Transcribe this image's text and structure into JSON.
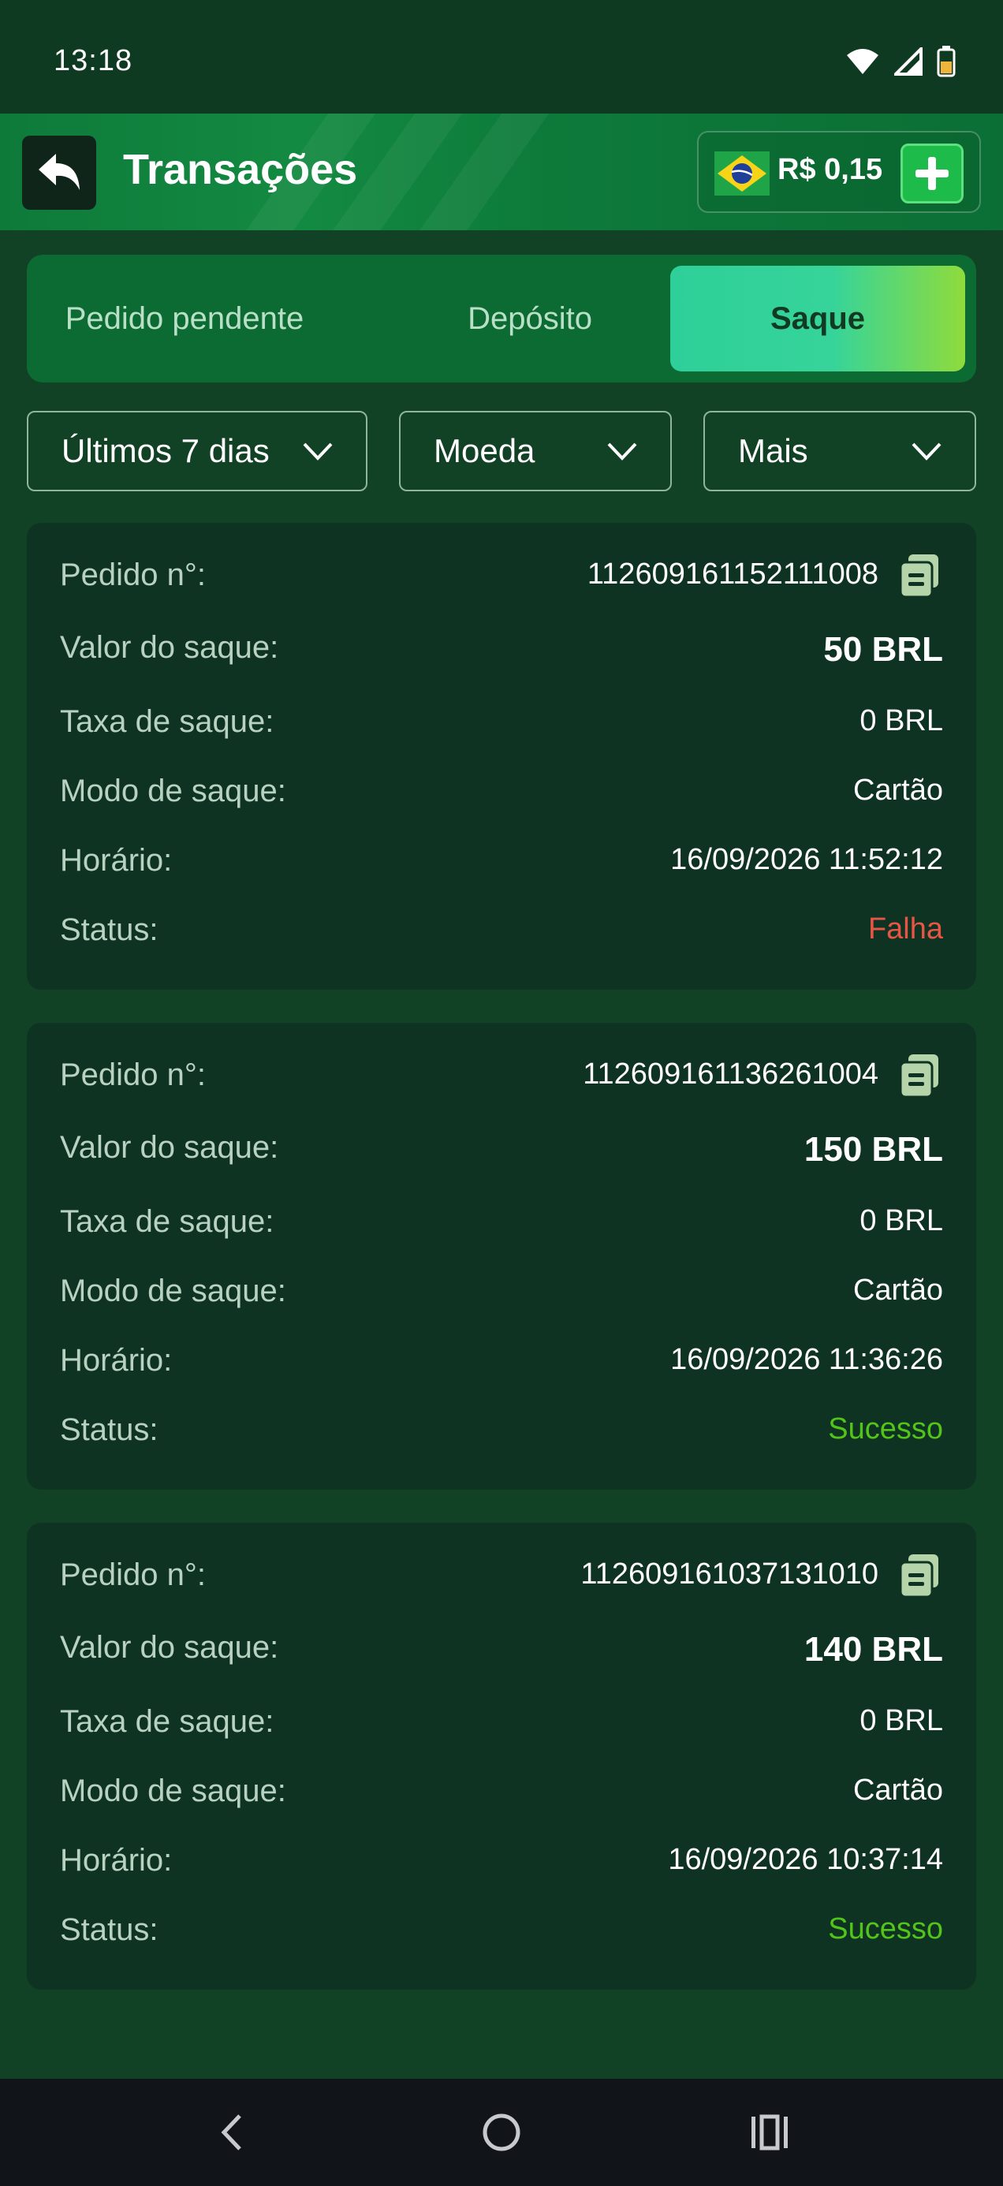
{
  "status_bar": {
    "time": "13:18"
  },
  "header": {
    "title": "Transações",
    "balance": "R$ 0,15"
  },
  "tabs": [
    {
      "label": "Pedido pendente",
      "active": false
    },
    {
      "label": "Depósito",
      "active": false
    },
    {
      "label": "Saque",
      "active": true
    }
  ],
  "filters": [
    {
      "label": "Últimos 7 dias"
    },
    {
      "label": "Moeda"
    },
    {
      "label": "Mais"
    }
  ],
  "labels": {
    "order": "Pedido n°:",
    "amount": "Valor do saque:",
    "fee": "Taxa de saque:",
    "mode": "Modo de saque:",
    "time": "Horário:",
    "status": "Status:"
  },
  "transactions": [
    {
      "order": "112609161152111008",
      "amount": "50 BRL",
      "fee": "0 BRL",
      "mode": "Cartão",
      "time": "16/09/2026 11:52:12",
      "status": "Falha"
    },
    {
      "order": "112609161136261004",
      "amount": "150 BRL",
      "fee": "0 BRL",
      "mode": "Cartão",
      "time": "16/09/2026 11:36:26",
      "status": "Sucesso"
    },
    {
      "order": "112609161037131010",
      "amount": "140 BRL",
      "fee": "0 BRL",
      "mode": "Cartão",
      "time": "16/09/2026 10:37:14",
      "status": "Sucesso"
    }
  ],
  "colors": {
    "accent": "#2ecf99",
    "success": "#52c41a",
    "failure": "#e85545",
    "background": "#124226"
  },
  "icons": {
    "back": "back-arrow-icon",
    "add": "plus-icon",
    "copy": "copy-icon",
    "dropdown": "chevron-down-icon"
  }
}
